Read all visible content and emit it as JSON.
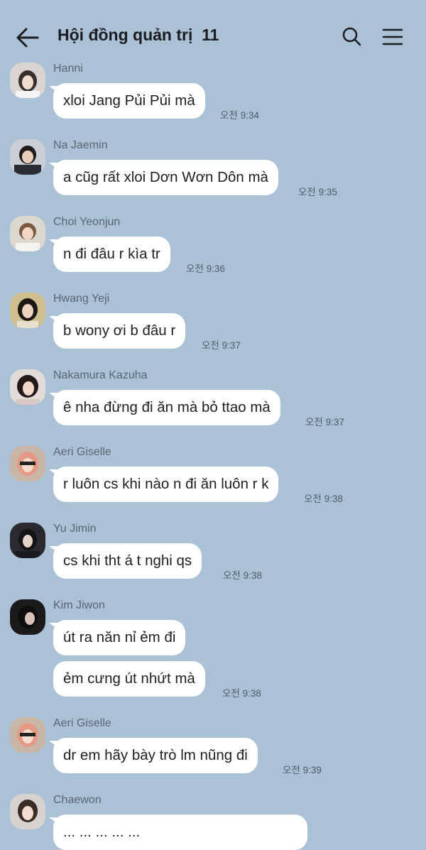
{
  "header": {
    "title": "Hội đồng quản trị  11"
  },
  "messages": [
    {
      "sender": "Hanni",
      "texts": [
        "xloi Jang Pủi Pủi mà"
      ],
      "time": "오전 9:34"
    },
    {
      "sender": "Na Jaemin",
      "texts": [
        "a cũg rất xloi Dơn Wơn Dôn mà"
      ],
      "time": "오전 9:35"
    },
    {
      "sender": "Choi Yeonjun",
      "texts": [
        "n đi đâu r kìa tr"
      ],
      "time": "오전 9:36"
    },
    {
      "sender": "Hwang Yeji",
      "texts": [
        "b wony ơi b đâu r"
      ],
      "time": "오전 9:37"
    },
    {
      "sender": "Nakamura Kazuha",
      "texts": [
        "ê nha đừng đi ăn mà bỏ ttao mà"
      ],
      "time": "오전 9:37"
    },
    {
      "sender": "Aeri Giselle",
      "texts": [
        "r luôn cs khi nào n đi ăn luôn r k"
      ],
      "time": "오전 9:38"
    },
    {
      "sender": "Yu Jimin",
      "texts": [
        "cs khi tht á t nghi qs"
      ],
      "time": "오전 9:38"
    },
    {
      "sender": "Kim Jiwon",
      "texts": [
        "út ra năn nỉ ẻm đi",
        "ẻm cưng út nhứt mà"
      ],
      "time": "오전 9:38"
    },
    {
      "sender": "Aeri Giselle",
      "texts": [
        "dr em hãy bày trò lm nũng đi"
      ],
      "time": "오전 9:39"
    },
    {
      "sender": "Chaewon",
      "texts": [
        "... ... ... ... ..."
      ],
      "time": ""
    }
  ],
  "colors": {
    "background": "#abc1d6",
    "bubble": "#ffffff"
  },
  "icons": [
    "back-arrow-icon",
    "search-icon",
    "menu-icon"
  ]
}
